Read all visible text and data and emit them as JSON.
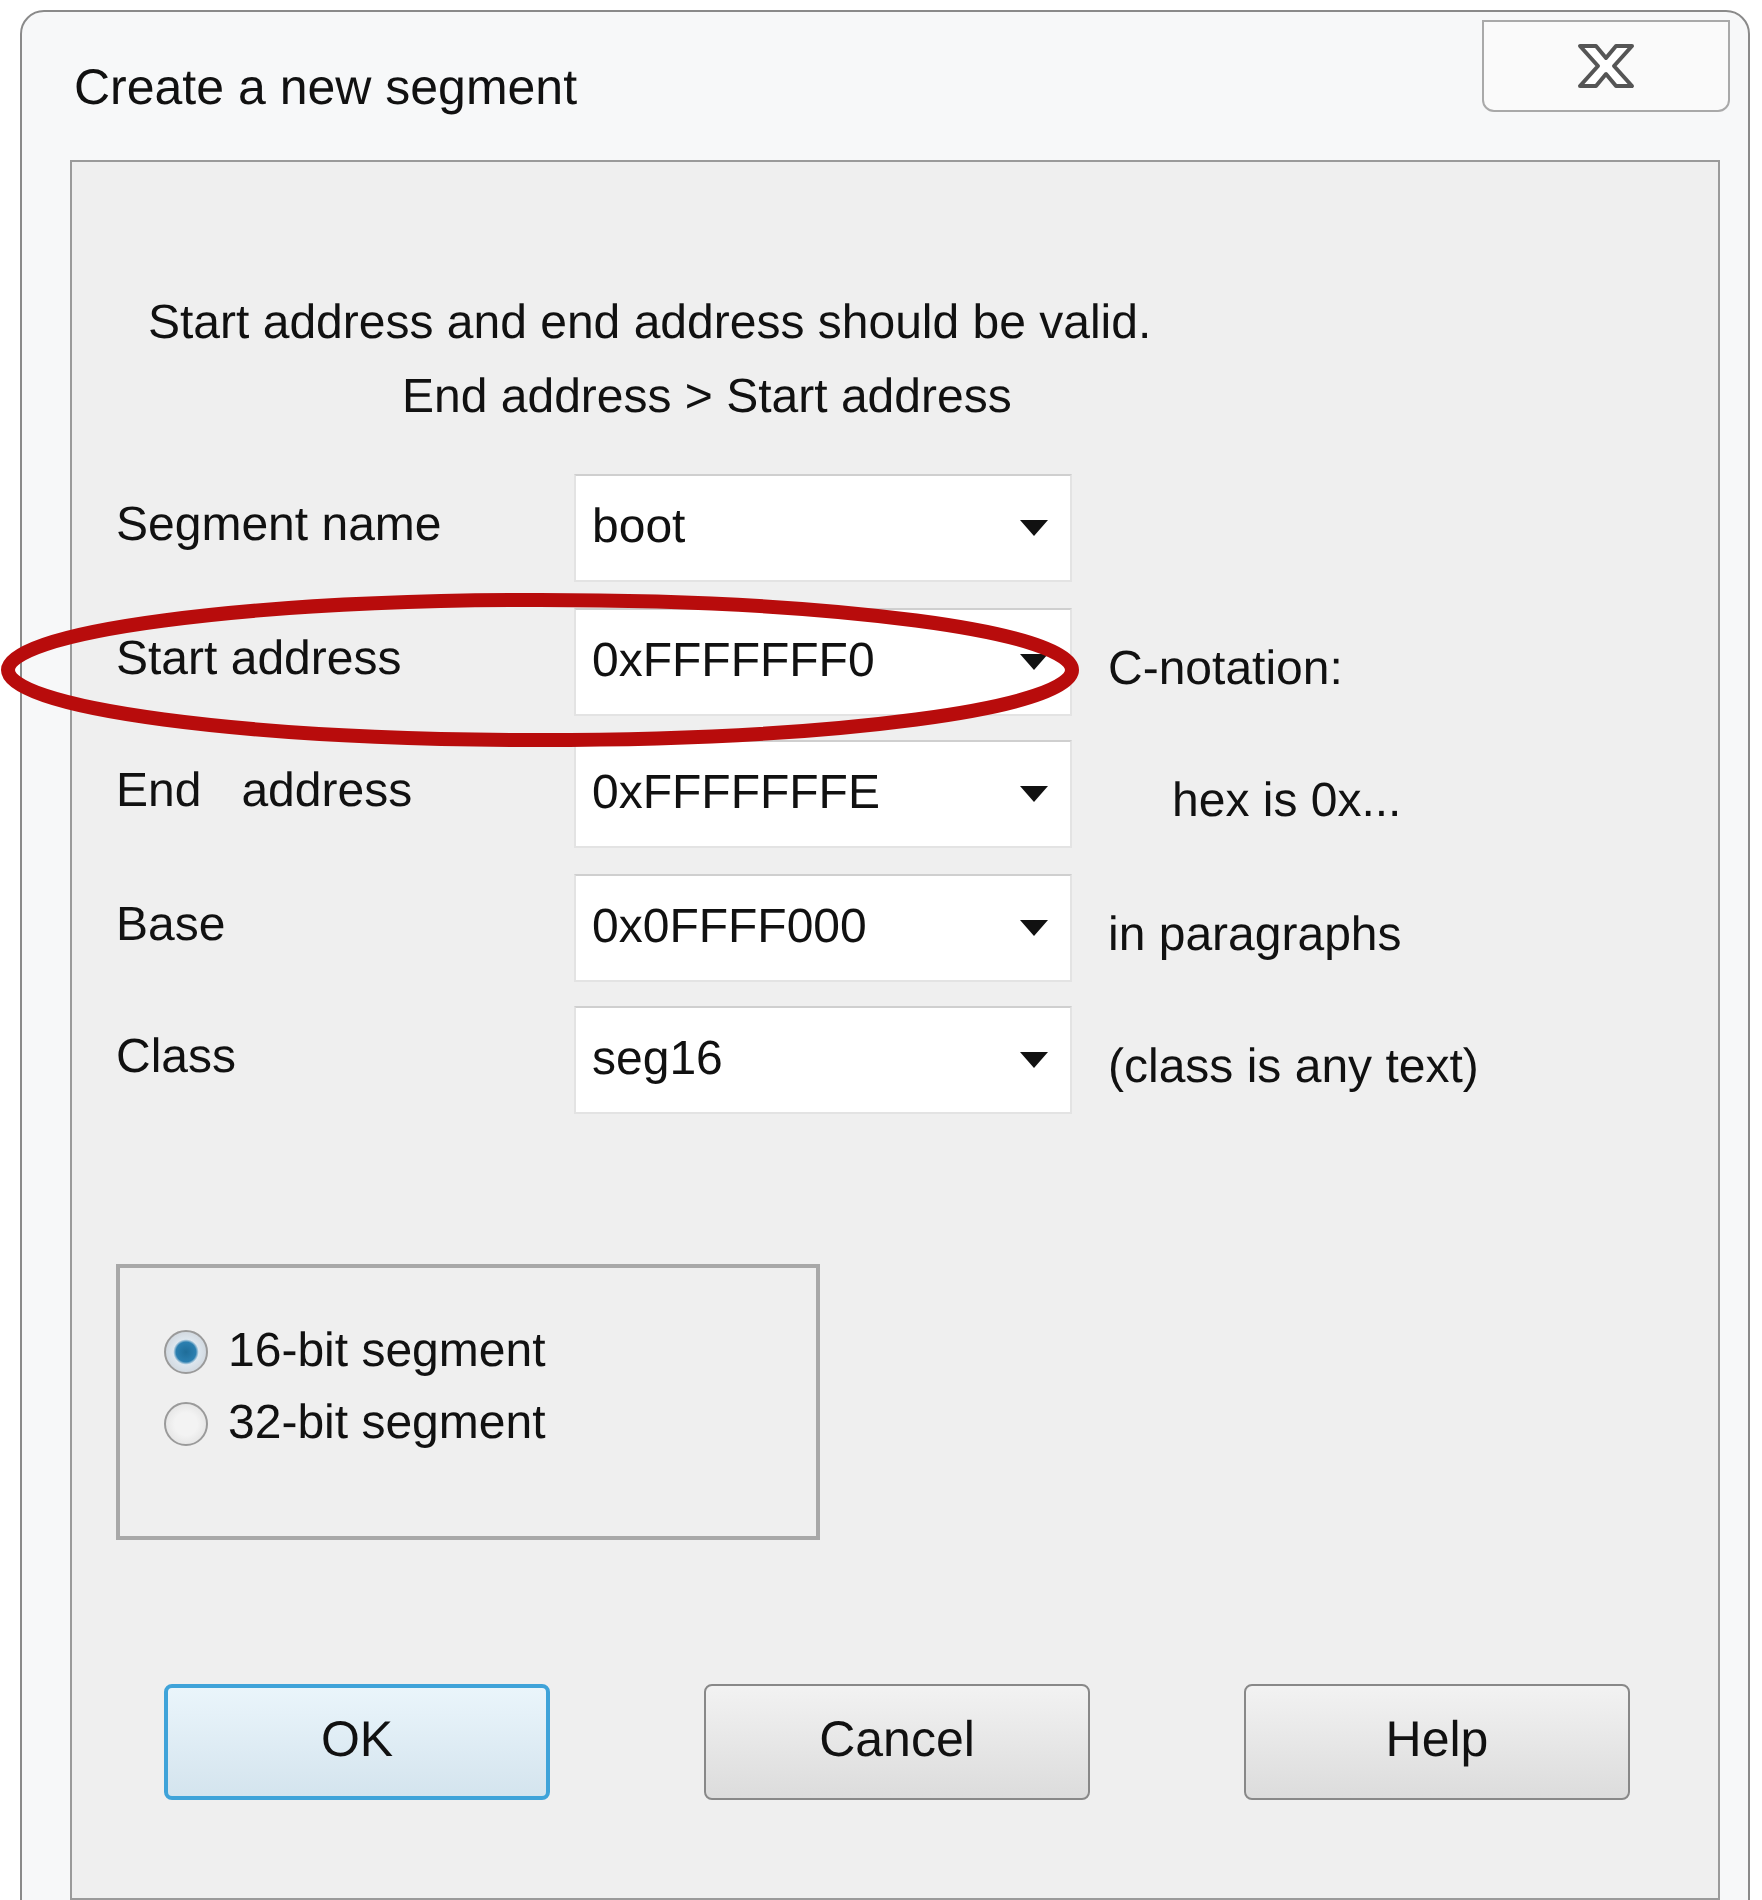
{
  "window": {
    "title": "Create a new segment"
  },
  "message": [
    "Start address and end address should be valid.",
    "End address > Start address"
  ],
  "fields": [
    {
      "label": "Segment name",
      "value": "boot"
    },
    {
      "label": "Start address",
      "value": "0xFFFFFFF0",
      "hint": "C-notation:"
    },
    {
      "label": "End   address",
      "value": "0xFFFFFFFE",
      "hint": "hex is 0x..."
    },
    {
      "label": "Base",
      "value": "0x0FFFF000",
      "hint": "in paragraphs"
    },
    {
      "label": "Class",
      "value": "seg16",
      "hint": "(class is any text)"
    }
  ],
  "segment_size": [
    {
      "label": "16-bit segment",
      "selected": true
    },
    {
      "label": "32-bit segment",
      "selected": false
    }
  ],
  "buttons": [
    {
      "label": "OK",
      "default": true
    },
    {
      "label": "Cancel",
      "default": false
    },
    {
      "label": "Help",
      "default": false
    }
  ],
  "annotation": {
    "kind": "ellipse",
    "color": "#b80c0c"
  }
}
